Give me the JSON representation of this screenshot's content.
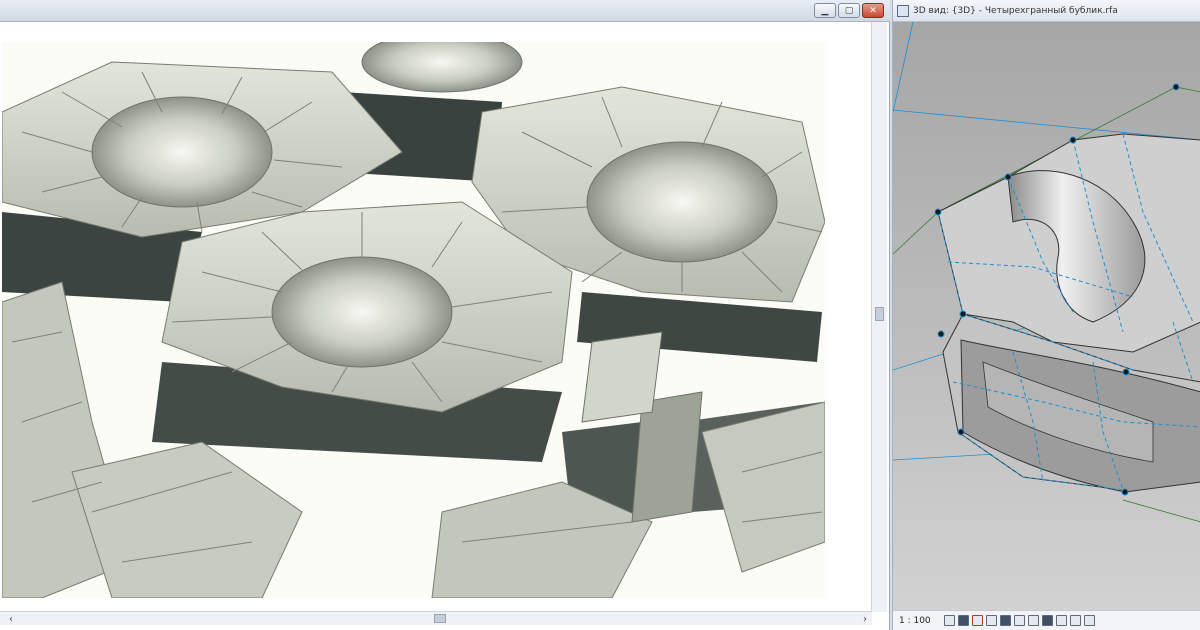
{
  "left_window": {
    "controls": {
      "minimize": "▁",
      "maximize": "▢",
      "close": "✕"
    },
    "scroll_left_arrow": "‹",
    "scroll_right_arrow": "›"
  },
  "right_window": {
    "title": "3D вид: {3D} - Четырехгранный бублик.rfa",
    "view_scale": "1 : 100",
    "status_icons": [
      "detail-level-icon",
      "visual-style-icon",
      "sun-path-icon",
      "shadows-icon",
      "render-icon",
      "crop-icon",
      "show-crop-icon",
      "lock-view-icon",
      "temp-hide-icon",
      "reveal-hidden-icon",
      "analysis-icon"
    ]
  },
  "colors": {
    "render_panel": "#ccd0c4",
    "render_dark": "#3c4441",
    "view_background_top": "#a6a6a6",
    "view_background_bottom": "#d2d2d2",
    "edge_blue": "#1e8fd0",
    "edge_green": "#2e7d32"
  }
}
